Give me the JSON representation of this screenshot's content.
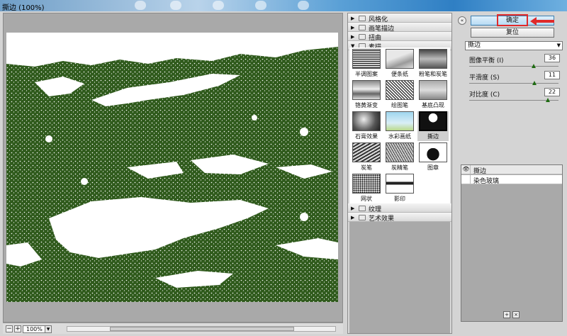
{
  "window": {
    "title": "撕边 (100%)"
  },
  "preview": {
    "zoom_value": "100%",
    "zoom_out_label": "−",
    "zoom_in_label": "+",
    "ink_color": "#2f5a1c"
  },
  "gallery": {
    "categories_top": [
      {
        "label": "风格化",
        "expanded": false
      },
      {
        "label": "画笔描边",
        "expanded": false
      },
      {
        "label": "扭曲",
        "expanded": false
      },
      {
        "label": "素描",
        "expanded": true
      }
    ],
    "filters": [
      {
        "label": "半调图案"
      },
      {
        "label": "便条纸"
      },
      {
        "label": "粉笔和炭笔"
      },
      {
        "label": "铬黄渐变"
      },
      {
        "label": "绘图笔"
      },
      {
        "label": "基底凸现"
      },
      {
        "label": "石膏效果"
      },
      {
        "label": "水彩画纸"
      },
      {
        "label": "撕边",
        "selected": true
      },
      {
        "label": "炭笔"
      },
      {
        "label": "炭精笔"
      },
      {
        "label": "图章"
      },
      {
        "label": "网状"
      },
      {
        "label": "影印"
      }
    ],
    "categories_bottom": [
      {
        "label": "纹理",
        "expanded": false
      },
      {
        "label": "艺术效果",
        "expanded": false
      }
    ]
  },
  "settings": {
    "ok_label": "确定",
    "reset_label": "复位",
    "filter_select": "撕边",
    "params": [
      {
        "label": "图像平衡 (I)",
        "value": "36",
        "fraction": 0.72
      },
      {
        "label": "平滑度 (S)",
        "value": "11",
        "fraction": 0.73
      },
      {
        "label": "对比度 (C)",
        "value": "22",
        "fraction": 0.88
      }
    ],
    "layers": [
      {
        "label": "撕边",
        "visible": true,
        "active": true
      },
      {
        "label": "染色玻璃",
        "visible": false,
        "active": false
      }
    ],
    "accent_color": "#e02a2a"
  }
}
